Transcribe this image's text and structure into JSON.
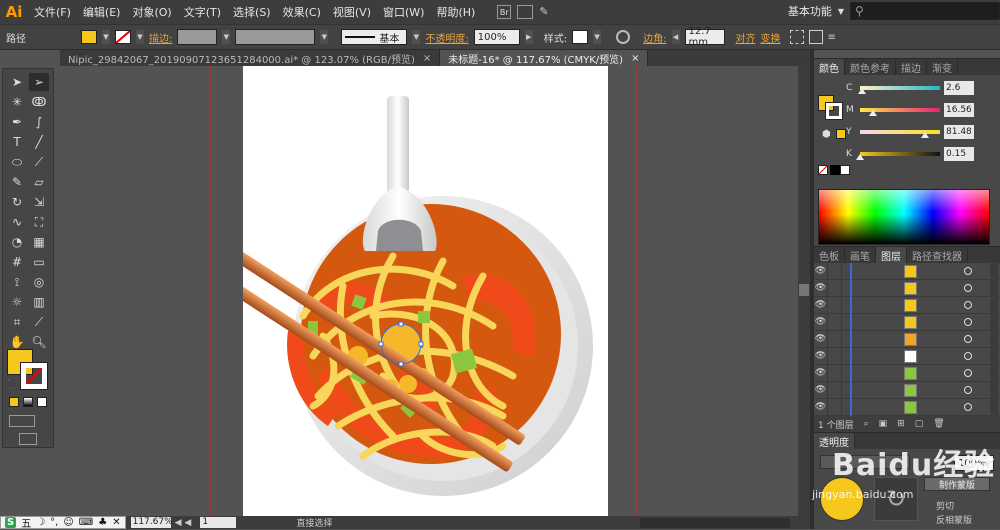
{
  "app": {
    "logo": "Ai"
  },
  "menu": [
    "文件(F)",
    "编辑(E)",
    "对象(O)",
    "文字(T)",
    "选择(S)",
    "效果(C)",
    "视图(V)",
    "窗口(W)",
    "帮助(H)"
  ],
  "workspace_label": "基本功能",
  "control_bar": {
    "object_type": "路径",
    "fill_color": "#f6c81e",
    "stroke_label": "描边:",
    "stroke_style": "基本",
    "opacity_label": "不透明度:",
    "opacity_value": "100%",
    "style_label": "样式:",
    "corner_label": "边角:",
    "corner_value": "12.7 mm",
    "align_label": "对齐",
    "transform_label": "变换"
  },
  "doc_tabs": [
    {
      "label": "Nipic_29842067_20190907123651284000.ai* @ 123.07% (RGB/预览)",
      "active": false,
      "close": "×"
    },
    {
      "label": "未标题-16* @ 117.67% (CMYK/预览)",
      "active": true,
      "close": "×"
    }
  ],
  "tools": {
    "fill_color": "#f6c81e",
    "icons": [
      "selection-arrow",
      "direct-selection",
      "magic-wand",
      "lasso",
      "pen",
      "curvature",
      "type",
      "line",
      "ellipse",
      "paintbrush",
      "pencil",
      "eraser",
      "rotate",
      "scale",
      "warp",
      "free-transform",
      "shape-builder",
      "perspective",
      "mesh",
      "gradient",
      "eyedropper",
      "blend",
      "symbol-sprayer",
      "column-graph",
      "artboard",
      "slice",
      "hand",
      "zoom"
    ]
  },
  "color_panel": {
    "tabs": [
      "颜色",
      "颜色参考",
      "描边",
      "渐变"
    ],
    "channels": [
      {
        "name": "C",
        "value": "2.6",
        "pct": 2.6
      },
      {
        "name": "M",
        "value": "16.56",
        "pct": 16.56
      },
      {
        "name": "Y",
        "value": "81.48",
        "pct": 81.48
      },
      {
        "name": "K",
        "value": "0.15",
        "pct": 0.15
      }
    ],
    "current_color": "#f6c81e"
  },
  "layers_panel": {
    "tabs": [
      "色板",
      "画笔",
      "图层",
      "路径查找器"
    ],
    "rows": [
      {
        "thumb": "#f6c81e"
      },
      {
        "thumb": "#f6c81e"
      },
      {
        "thumb": "#f6c81e"
      },
      {
        "thumb": "#f6c81e"
      },
      {
        "thumb": "#f0a52a"
      },
      {
        "thumb": "#ffffff"
      },
      {
        "thumb": "#8cc63f"
      },
      {
        "thumb": "#8cc63f"
      },
      {
        "thumb": "#8cc63f"
      }
    ],
    "count_label": "1 个图层"
  },
  "transparency": {
    "title": "透明度",
    "opacity": "100%",
    "make_mask": "制作蒙版",
    "clip": "剪切",
    "invert_mask": "反相蒙版"
  },
  "status": {
    "zoom": "117.67%",
    "artboard": "1",
    "tool": "直接选择"
  },
  "ime": {
    "logo": "S",
    "mode": "五"
  },
  "watermark": {
    "text": "Baidu经验",
    "url": "jingyan.baidu.com"
  }
}
